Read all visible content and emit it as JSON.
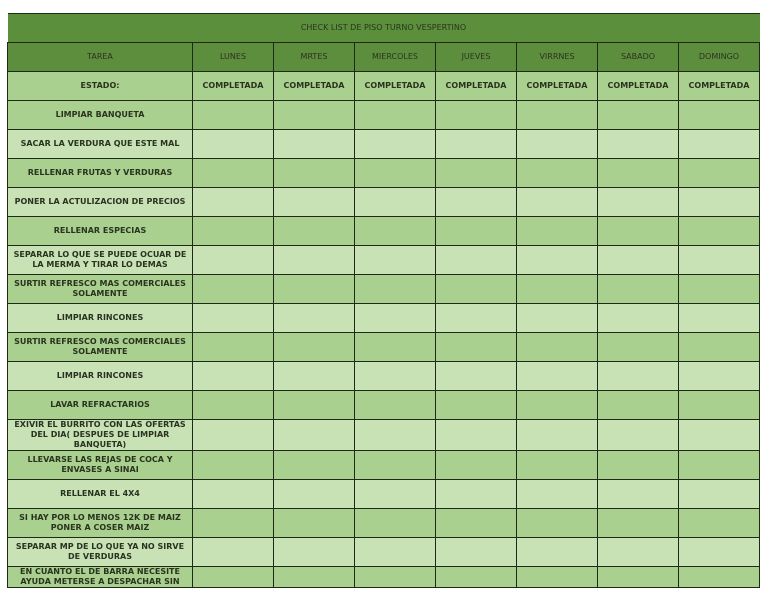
{
  "title": "CHECK LIST  DE PISO TURNO VESPERTINO",
  "headers": [
    "TAREA",
    "LUNES",
    "MRTES",
    "MIERCOLES",
    "JUEVES",
    "VIRRNES",
    "SABADO",
    "DOMINGO"
  ],
  "estado": {
    "label": "ESTADO:",
    "values": [
      "COMPLETADA",
      "COMPLETADA",
      "COMPLETADA",
      "COMPLETADA",
      "COMPLETADA",
      "COMPLETADA",
      "COMPLETADA"
    ]
  },
  "tasks": [
    "LIMPIAR BANQUETA",
    "SACAR LA VERDURA QUE ESTE MAL",
    "RELLENAR FRUTAS Y VERDURAS",
    "PONER LA ACTULIZACION DE PRECIOS",
    "RELLENAR ESPECIAS",
    "SEPARAR LO QUE SE PUEDE OCUAR DE LA MERMA Y TIRAR LO DEMAS",
    "SURTIR REFRESCO  MAS COMERCIALES SOLAMENTE",
    "LIMPIAR RINCONES",
    "SURTIR REFRESCO  MAS COMERCIALES SOLAMENTE",
    "LIMPIAR RINCONES",
    "LAVAR REFRACTARIOS",
    "EXIVIR EL BURRITO CON LAS OFERTAS DEL DIA( DESPUES DE LIMPIAR BANQUETA)",
    "LLEVARSE LAS REJAS DE COCA Y ENVASES A SINAI",
    "RELLENAR EL 4X4",
    "SI HAY POR LO MENOS 12K DE MAIZ PONER A COSER MAIZ",
    "SEPARAR MP DE LO QUE YA NO SIRVE DE VERDURAS",
    "EN CUANTO EL DE BARRA NECESITE AYUDA METERSE A DESPACHAR SIN"
  ]
}
